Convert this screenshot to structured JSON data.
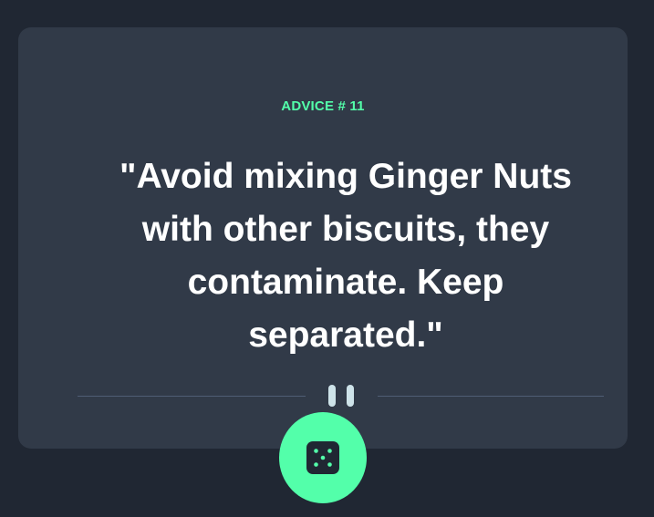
{
  "card": {
    "label": "ADVICE # 11",
    "quote": "\"Avoid mixing Ginger Nuts with other biscuits, they contaminate. Keep separated.\""
  },
  "divider": {
    "icon": "pause-icon"
  },
  "button": {
    "icon": "dice-icon"
  },
  "colors": {
    "background": "#202733",
    "card": "#313a48",
    "accent": "#53ffaa",
    "text": "#ffffff",
    "divider": "#4f5d74",
    "pause": "#cee3e9"
  }
}
